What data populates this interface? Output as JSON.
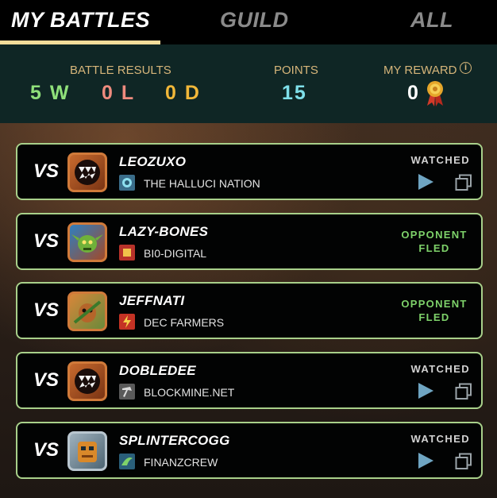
{
  "tabs": [
    {
      "label": "MY BATTLES",
      "active": true
    },
    {
      "label": "GUILD",
      "active": false
    },
    {
      "label": "ALL",
      "active": false
    }
  ],
  "summary": {
    "battle_results_label": "BATTLE RESULTS",
    "wins": "5 W",
    "losses": "0 L",
    "draws": "0 D",
    "points_label": "POINTS",
    "points": "15",
    "reward_label": "MY REWARD",
    "reward": "0",
    "reward_icon": "medal-icon",
    "info_icon": "i"
  },
  "vs_label": "VS",
  "battles": [
    {
      "opponent": "LEOZUXO",
      "guild": "THE HALLUCI NATION",
      "status": "WATCHED",
      "avatar": "monster-mouth"
    },
    {
      "opponent": "LAZY-BONES",
      "guild": "BI0-DIGITAL",
      "status_line1": "OPPONENT",
      "status_line2": "FLED",
      "avatar": "goblin"
    },
    {
      "opponent": "JEFFNATI",
      "guild": "DEC FARMERS",
      "status_line1": "OPPONENT",
      "status_line2": "FLED",
      "avatar": "creature"
    },
    {
      "opponent": "DOBLEDEE",
      "guild": "BLOCKMINE.NET",
      "status": "WATCHED",
      "avatar": "monster-mouth"
    },
    {
      "opponent": "SPLINTERCOGG",
      "guild": "FINANZCREW",
      "status": "WATCHED",
      "avatar": "robot"
    }
  ],
  "colors": {
    "wins": "#8fe07a",
    "losses": "#ee8b7e",
    "draws": "#f1b739",
    "points": "#7fe0ea",
    "card_border": "#a8d08a",
    "fled": "#7ed26a"
  }
}
